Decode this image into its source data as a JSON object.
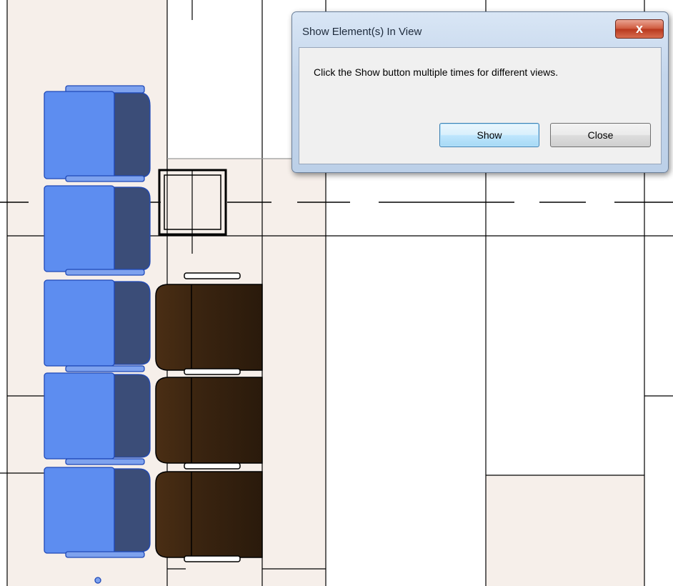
{
  "dialog": {
    "title": "Show Element(s) In View",
    "close_glyph": "x",
    "message": "Click the Show button multiple times for different views.",
    "show_label": "Show",
    "close_label": "Close"
  },
  "view": {
    "room_fill": "#f6efea",
    "selected_chair_color": "#4f82e8",
    "chair_color": "#3a2410",
    "line_color": "#000000",
    "selected_chair_count": 5,
    "chair_count": 3
  }
}
